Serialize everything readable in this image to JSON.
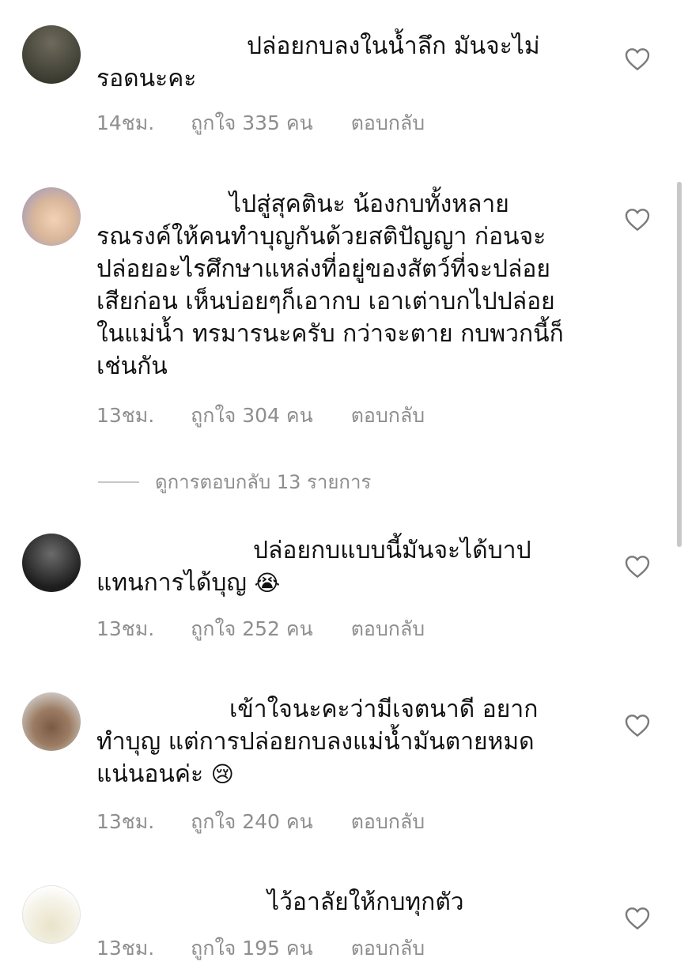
{
  "comments": [
    {
      "text": "ปล่อยกบลงในน้ำลึก มันจะไม่\nรอดนะคะ",
      "time": "14ชม.",
      "likes": "ถูกใจ 335 คน",
      "reply": "ตอบกลับ"
    },
    {
      "text": "ไปสู่สุคตินะ น้องกบทั้งหลาย\nรณรงค์ให้คนทำบุญกันด้วยสติปัญญา ก่อนจะ\nปล่อยอะไรศึกษาแหล่งที่อยู่ของสัตว์ที่จะปล่อย\nเสียก่อน เห็นบ่อยๆก็เอากบ เอาเต่าบกไปปล่อย\nในแม่น้ำ ทรมารนะครับ กว่าจะตาย กบพวกนี้ก็\nเช่นกัน",
      "time": "13ชม.",
      "likes": "ถูกใจ 304 คน",
      "reply": "ตอบกลับ"
    },
    {
      "text": "ปล่อยกบแบบนี้มันจะได้บาป\nแทนการได้บุญ",
      "emoji": "😭",
      "time": "13ชม.",
      "likes": "ถูกใจ 252 คน",
      "reply": "ตอบกลับ"
    },
    {
      "text": "เข้าใจนะคะว่ามีเจตนาดี อยาก\nทำบุญ แต่การปล่อยกบลงแม่น้ำมันตายหมด\nแน่นอนค่ะ",
      "emoji": "😢",
      "time": "13ชม.",
      "likes": "ถูกใจ 240 คน",
      "reply": "ตอบกลับ"
    },
    {
      "text": "ไว้อาลัยให้กบทุกตัว",
      "time": "13ชม.",
      "likes": "ถูกใจ 195 คน",
      "reply": "ตอบกลับ"
    }
  ],
  "view_replies": "ดูการตอบกลับ 13 รายการ",
  "icons": {
    "like": "heart-outline-icon"
  },
  "colors": {
    "meta": "#8e8e8e",
    "text": "#111111",
    "background": "#ffffff"
  }
}
